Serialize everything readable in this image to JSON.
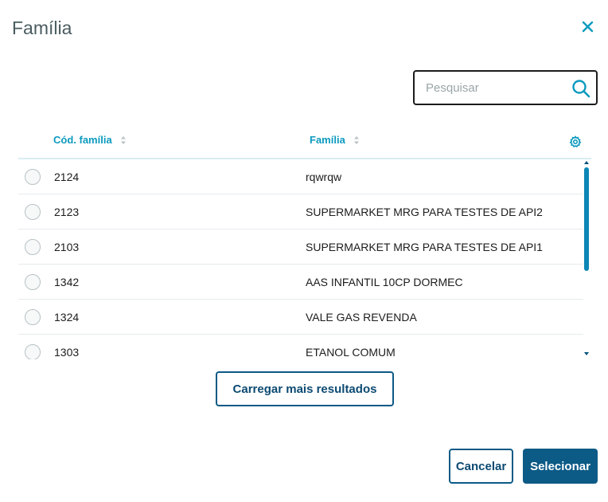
{
  "modal": {
    "title": "Família"
  },
  "search": {
    "placeholder": "Pesquisar",
    "value": ""
  },
  "table": {
    "columns": [
      {
        "label": "Cód. família"
      },
      {
        "label": "Família"
      }
    ],
    "rows": [
      {
        "code": "2124",
        "family": "rqwrqw"
      },
      {
        "code": "2123",
        "family": "SUPERMARKET MRG PARA TESTES DE API2"
      },
      {
        "code": "2103",
        "family": "SUPERMARKET MRG PARA TESTES DE API1"
      },
      {
        "code": "1342",
        "family": "AAS INFANTIL 10CP DORMEC"
      },
      {
        "code": "1324",
        "family": "VALE GAS REVENDA"
      },
      {
        "code": "1303",
        "family": "ETANOL COMUM"
      }
    ]
  },
  "actions": {
    "load_more": "Carregar mais resultados",
    "cancel": "Cancelar",
    "select": "Selecionar"
  },
  "icons": {
    "close": "close-icon",
    "search": "search-icon",
    "sort": "sort-icon",
    "settings": "gear-icon"
  },
  "colors": {
    "accent": "#0c9abe",
    "primary": "#0c5a86",
    "title": "#4a5c60"
  }
}
